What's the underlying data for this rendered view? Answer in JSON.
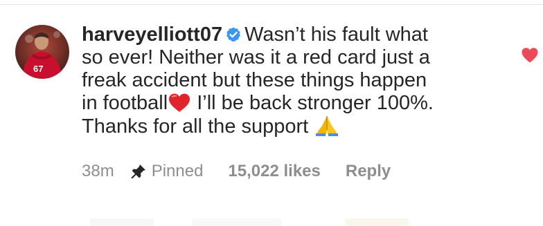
{
  "comment": {
    "username": "harveyelliott07",
    "verified": true,
    "lines": {
      "line1": "Wasn’t his fault what",
      "line2": "so ever! Neither was it a red card just a",
      "line3": "freak accident but these things happen",
      "line4a": "in football",
      "line4b": " I’ll be back stronger 100%.",
      "line5": "Thanks for all the support "
    }
  },
  "avatar": {
    "jersey_number": "67"
  },
  "meta": {
    "time": "38m",
    "pinned_label": "Pinned",
    "likes_label": "15,022 likes",
    "reply_label": "Reply"
  },
  "colors": {
    "text": "#262626",
    "secondary_text": "#8e8e8e",
    "verified_blue": "#3897f0",
    "like_red": "#ed4956"
  },
  "icons": {
    "verified": "verified-badge-icon",
    "red_heart_emoji": "red-heart-icon",
    "folded_hands_emoji": "folded-hands-icon",
    "pin": "pin-icon",
    "like": "heart-like-icon"
  }
}
